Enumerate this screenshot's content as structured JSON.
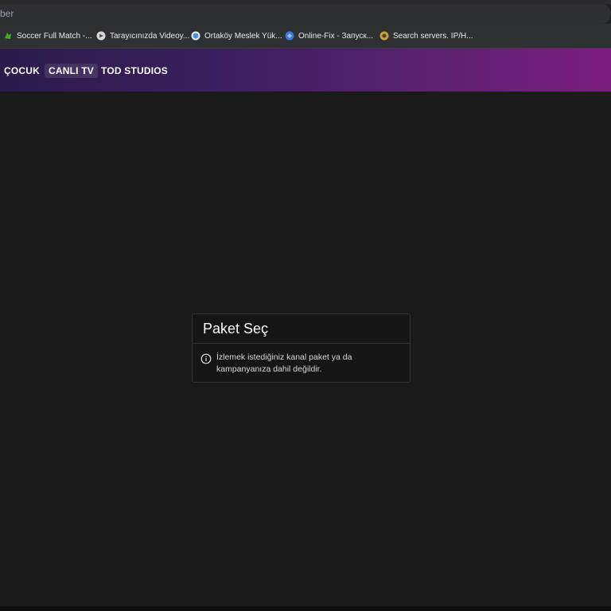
{
  "browser": {
    "address_text": "ber",
    "bookmarks": [
      {
        "label": "Soccer Full Match -...",
        "icon": "soccer-icon",
        "color": "#3fae2a"
      },
      {
        "label": "Tarayıcınızda Videoy...",
        "icon": "video-icon",
        "color": "#d9d9d9"
      },
      {
        "label": "Ortaköy Meslek Yük...",
        "icon": "school-icon",
        "color": "#4a90d9"
      },
      {
        "label": "Online-Fix - Запуск...",
        "icon": "online-fix-icon",
        "color": "#3b7bd6"
      },
      {
        "label": "Search servers. IP/H...",
        "icon": "server-icon",
        "color": "#c8a040"
      }
    ]
  },
  "nav": {
    "items": [
      {
        "label": "ÇOCUK",
        "active": false
      },
      {
        "label": "CANLI TV",
        "active": true
      },
      {
        "label": "TOD STUDIOS",
        "active": false
      }
    ],
    "gradient_start": "#2a1b4a",
    "gradient_end": "#7c1d80"
  },
  "modal": {
    "title": "Paket Seç",
    "message": "İzlemek istediğiniz kanal paket ya da kampanyanıza dahil değildir.",
    "icon": "info-icon"
  }
}
